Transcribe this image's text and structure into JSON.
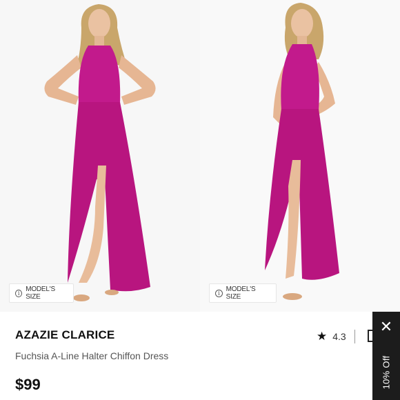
{
  "product": {
    "brand": "AZAZIE CLARICE",
    "subtitle": "Fuchsia A-Line Halter Chiffon Dress",
    "price": "$99",
    "rating": "4.3"
  },
  "images": [
    {
      "badge": "MODEL'S SIZE",
      "dress_color": "#c21a8c",
      "hair_color": "#c9a66b"
    },
    {
      "badge": "MODEL'S SIZE",
      "dress_color": "#c21a8c",
      "hair_color": "#c9a66b"
    }
  ],
  "promo": {
    "label": "10% Off",
    "close_glyph": "✕"
  },
  "icons": {
    "info": "info-icon",
    "star": "star-icon",
    "ruler": "ruler-icon",
    "close": "close-icon"
  }
}
